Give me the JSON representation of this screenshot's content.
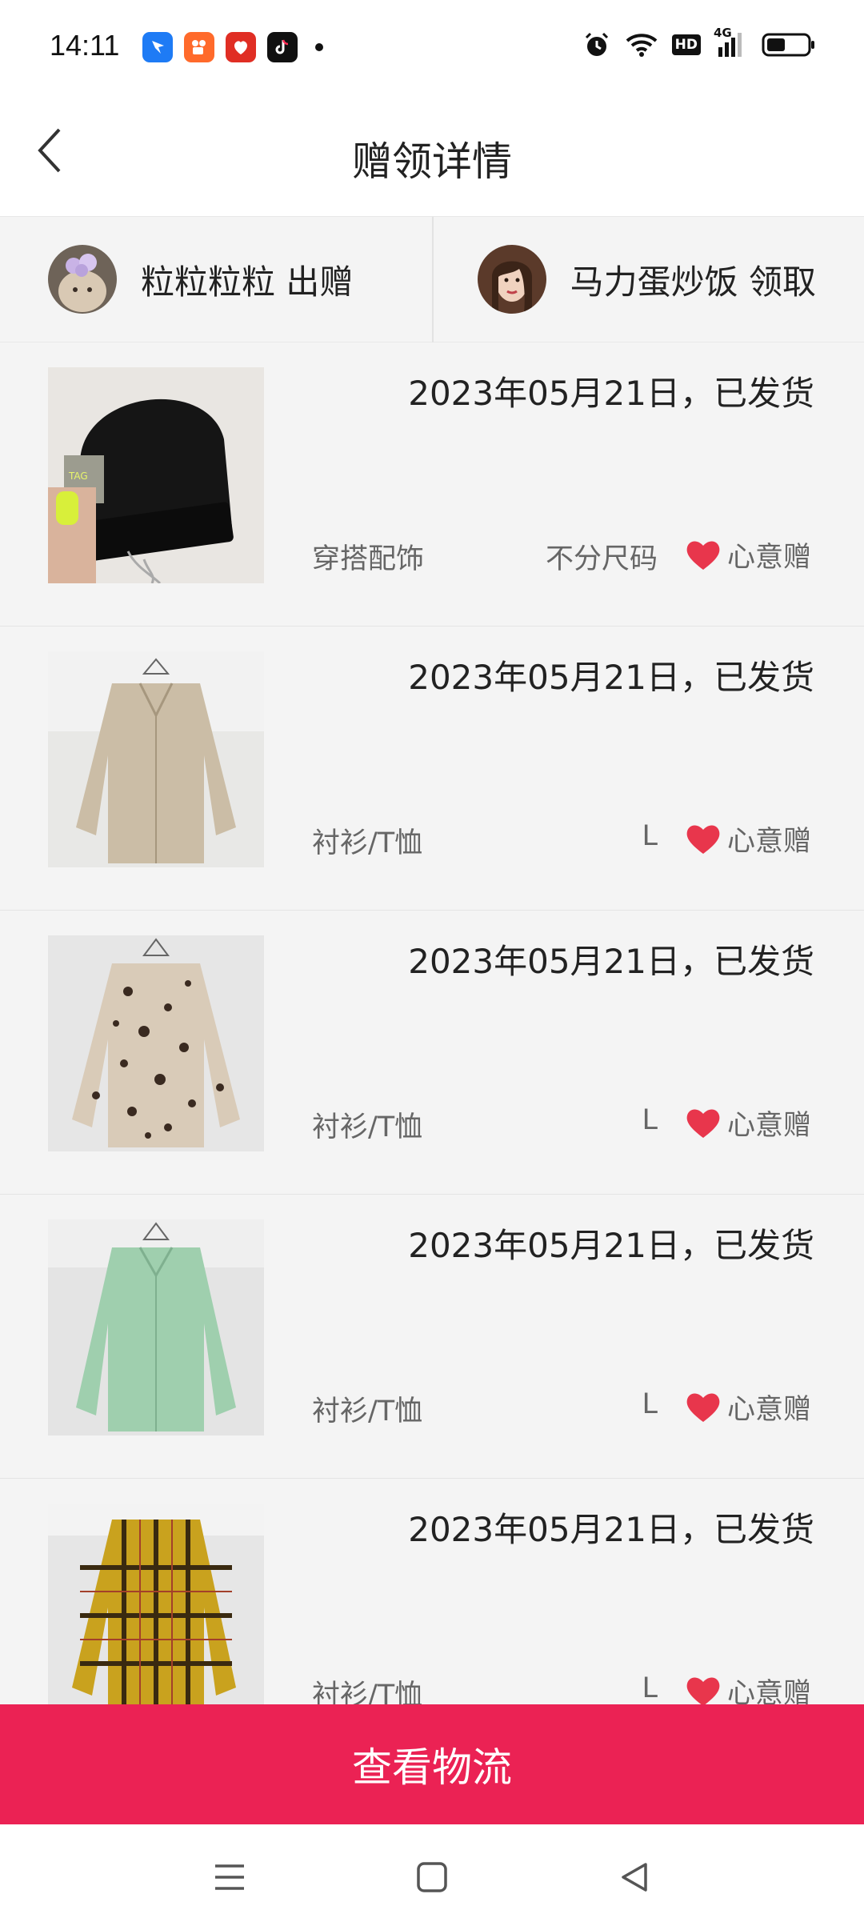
{
  "status_bar": {
    "time": "14:11",
    "apps": [
      "dingtalk-icon",
      "kuaishou-icon",
      "pinduoduo-icon",
      "tiktok-icon"
    ],
    "right_icons": [
      "alarm-icon",
      "wifi-icon",
      "hd-icon",
      "signal-4g-icon",
      "battery-icon"
    ],
    "hd_label": "HD",
    "net_label": "4G"
  },
  "header": {
    "title": "赠领详情"
  },
  "parties": {
    "giver": {
      "name_text": "粒粒粒粒 出赠"
    },
    "receiver": {
      "name_text": "马力蛋炒饭 领取"
    }
  },
  "items": [
    {
      "status": "2023年05月21日，已发货",
      "category": "穿搭配饰",
      "size": "不分尺码",
      "tag": "心意赠",
      "image": "black-beanie"
    },
    {
      "status": "2023年05月21日，已发货",
      "category": "衬衫/T恤",
      "size": "L",
      "tag": "心意赠",
      "image": "beige-shirt"
    },
    {
      "status": "2023年05月21日，已发货",
      "category": "衬衫/T恤",
      "size": "L",
      "tag": "心意赠",
      "image": "leopard-shirt"
    },
    {
      "status": "2023年05月21日，已发货",
      "category": "衬衫/T恤",
      "size": "L",
      "tag": "心意赠",
      "image": "mint-shirt"
    },
    {
      "status": "2023年05月21日，已发货",
      "category": "衬衫/T恤",
      "size": "L",
      "tag": "心意赠",
      "image": "plaid-shirt"
    }
  ],
  "cta": {
    "label": "查看物流"
  },
  "colors": {
    "accent": "#eb2254",
    "heart": "#e8364c",
    "background": "#f4f4f4"
  },
  "navbar": {
    "icons": [
      "menu-icon",
      "home-icon",
      "back-triangle-icon"
    ]
  }
}
